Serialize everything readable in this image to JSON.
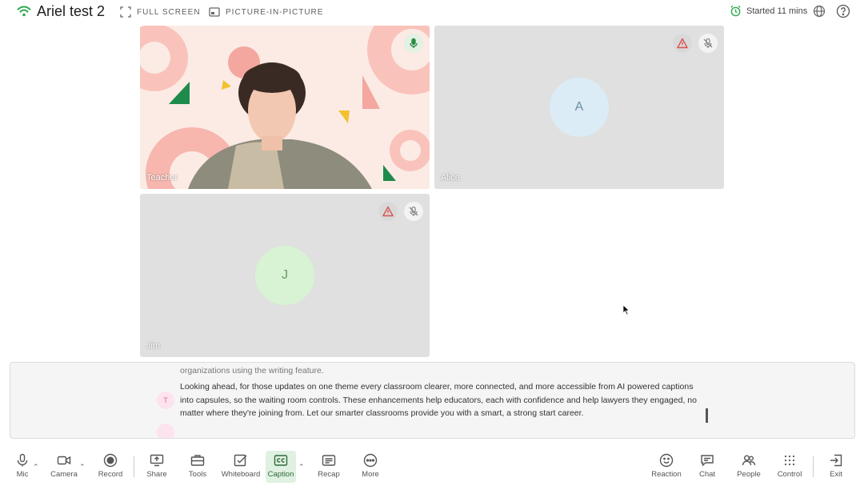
{
  "header": {
    "title": "Ariel test 2",
    "fullscreen_label": "FULL SCREEN",
    "pip_label": "PICTURE-IN-PICTURE",
    "started_label": "Started 11 mins"
  },
  "tiles": [
    {
      "name": "Teacher",
      "status": "mic-on"
    },
    {
      "name": "Alice",
      "initial": "A",
      "status": "muted-warning"
    },
    {
      "name": "Jim",
      "initial": "J",
      "status": "muted-warning"
    }
  ],
  "caption": {
    "previous_line": "organizations using the writing feature.",
    "speaker_initial": "T",
    "text": "Looking ahead, for those updates on one theme every classroom clearer, more connected, and more accessible from AI powered captions into capsules, so the waiting room controls. These enhancements help educators, each with confidence and help lawyers they engaged, no matter where they're joining from. Let our smarter classrooms provide you with a smart, a strong start career."
  },
  "toolbar": {
    "mic": "Mic",
    "camera": "Camera",
    "record": "Record",
    "share": "Share",
    "tools": "Tools",
    "whiteboard": "Whiteboard",
    "caption": "Caption",
    "recap": "Recap",
    "more": "More",
    "reaction": "Reaction",
    "chat": "Chat",
    "people": "People",
    "control": "Control",
    "exit": "Exit"
  },
  "colors": {
    "accent_green": "#2fa84f",
    "warning_red": "#d9534f"
  }
}
